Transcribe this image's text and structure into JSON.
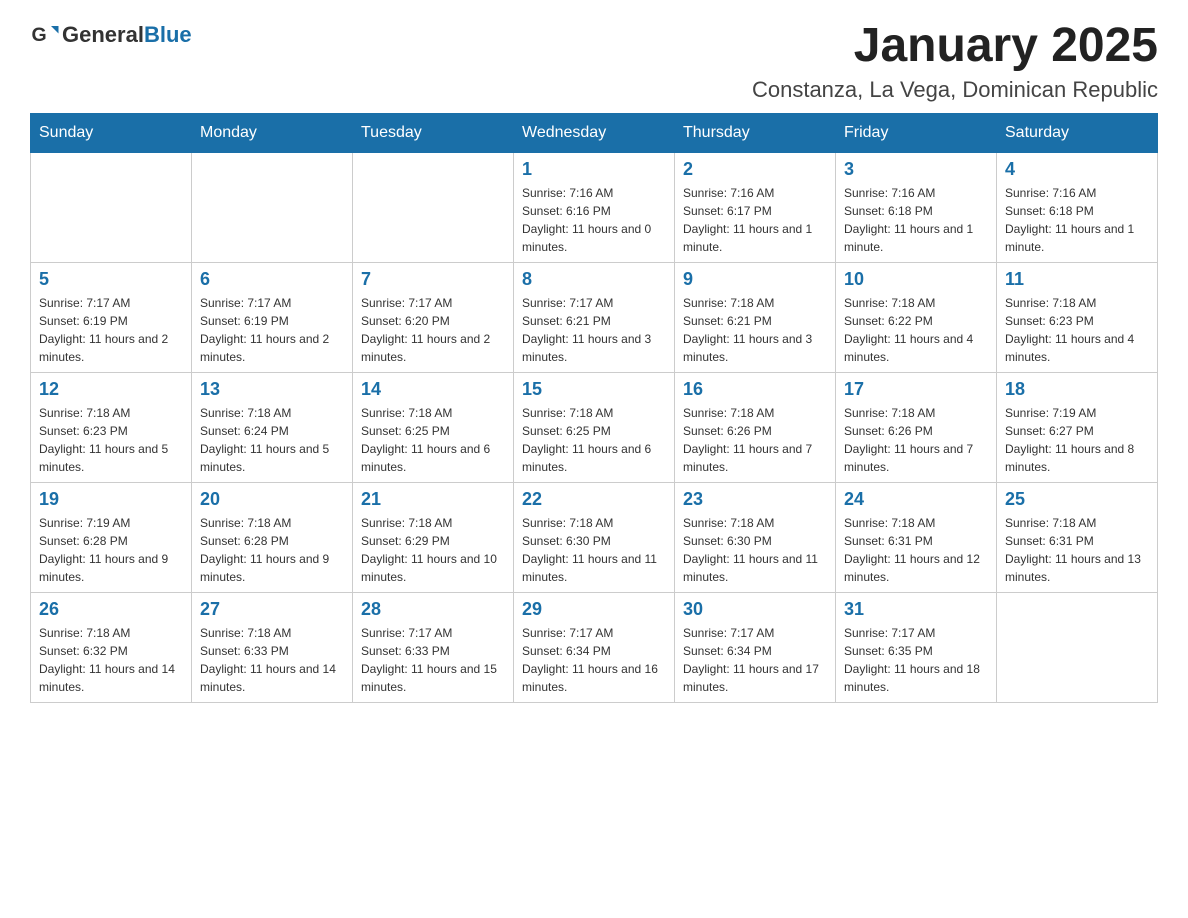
{
  "logo": {
    "general": "General",
    "blue": "Blue"
  },
  "header": {
    "month": "January 2025",
    "location": "Constanza, La Vega, Dominican Republic"
  },
  "weekdays": [
    "Sunday",
    "Monday",
    "Tuesday",
    "Wednesday",
    "Thursday",
    "Friday",
    "Saturday"
  ],
  "weeks": [
    [
      {
        "day": "",
        "info": ""
      },
      {
        "day": "",
        "info": ""
      },
      {
        "day": "",
        "info": ""
      },
      {
        "day": "1",
        "info": "Sunrise: 7:16 AM\nSunset: 6:16 PM\nDaylight: 11 hours and 0 minutes."
      },
      {
        "day": "2",
        "info": "Sunrise: 7:16 AM\nSunset: 6:17 PM\nDaylight: 11 hours and 1 minute."
      },
      {
        "day": "3",
        "info": "Sunrise: 7:16 AM\nSunset: 6:18 PM\nDaylight: 11 hours and 1 minute."
      },
      {
        "day": "4",
        "info": "Sunrise: 7:16 AM\nSunset: 6:18 PM\nDaylight: 11 hours and 1 minute."
      }
    ],
    [
      {
        "day": "5",
        "info": "Sunrise: 7:17 AM\nSunset: 6:19 PM\nDaylight: 11 hours and 2 minutes."
      },
      {
        "day": "6",
        "info": "Sunrise: 7:17 AM\nSunset: 6:19 PM\nDaylight: 11 hours and 2 minutes."
      },
      {
        "day": "7",
        "info": "Sunrise: 7:17 AM\nSunset: 6:20 PM\nDaylight: 11 hours and 2 minutes."
      },
      {
        "day": "8",
        "info": "Sunrise: 7:17 AM\nSunset: 6:21 PM\nDaylight: 11 hours and 3 minutes."
      },
      {
        "day": "9",
        "info": "Sunrise: 7:18 AM\nSunset: 6:21 PM\nDaylight: 11 hours and 3 minutes."
      },
      {
        "day": "10",
        "info": "Sunrise: 7:18 AM\nSunset: 6:22 PM\nDaylight: 11 hours and 4 minutes."
      },
      {
        "day": "11",
        "info": "Sunrise: 7:18 AM\nSunset: 6:23 PM\nDaylight: 11 hours and 4 minutes."
      }
    ],
    [
      {
        "day": "12",
        "info": "Sunrise: 7:18 AM\nSunset: 6:23 PM\nDaylight: 11 hours and 5 minutes."
      },
      {
        "day": "13",
        "info": "Sunrise: 7:18 AM\nSunset: 6:24 PM\nDaylight: 11 hours and 5 minutes."
      },
      {
        "day": "14",
        "info": "Sunrise: 7:18 AM\nSunset: 6:25 PM\nDaylight: 11 hours and 6 minutes."
      },
      {
        "day": "15",
        "info": "Sunrise: 7:18 AM\nSunset: 6:25 PM\nDaylight: 11 hours and 6 minutes."
      },
      {
        "day": "16",
        "info": "Sunrise: 7:18 AM\nSunset: 6:26 PM\nDaylight: 11 hours and 7 minutes."
      },
      {
        "day": "17",
        "info": "Sunrise: 7:18 AM\nSunset: 6:26 PM\nDaylight: 11 hours and 7 minutes."
      },
      {
        "day": "18",
        "info": "Sunrise: 7:19 AM\nSunset: 6:27 PM\nDaylight: 11 hours and 8 minutes."
      }
    ],
    [
      {
        "day": "19",
        "info": "Sunrise: 7:19 AM\nSunset: 6:28 PM\nDaylight: 11 hours and 9 minutes."
      },
      {
        "day": "20",
        "info": "Sunrise: 7:18 AM\nSunset: 6:28 PM\nDaylight: 11 hours and 9 minutes."
      },
      {
        "day": "21",
        "info": "Sunrise: 7:18 AM\nSunset: 6:29 PM\nDaylight: 11 hours and 10 minutes."
      },
      {
        "day": "22",
        "info": "Sunrise: 7:18 AM\nSunset: 6:30 PM\nDaylight: 11 hours and 11 minutes."
      },
      {
        "day": "23",
        "info": "Sunrise: 7:18 AM\nSunset: 6:30 PM\nDaylight: 11 hours and 11 minutes."
      },
      {
        "day": "24",
        "info": "Sunrise: 7:18 AM\nSunset: 6:31 PM\nDaylight: 11 hours and 12 minutes."
      },
      {
        "day": "25",
        "info": "Sunrise: 7:18 AM\nSunset: 6:31 PM\nDaylight: 11 hours and 13 minutes."
      }
    ],
    [
      {
        "day": "26",
        "info": "Sunrise: 7:18 AM\nSunset: 6:32 PM\nDaylight: 11 hours and 14 minutes."
      },
      {
        "day": "27",
        "info": "Sunrise: 7:18 AM\nSunset: 6:33 PM\nDaylight: 11 hours and 14 minutes."
      },
      {
        "day": "28",
        "info": "Sunrise: 7:17 AM\nSunset: 6:33 PM\nDaylight: 11 hours and 15 minutes."
      },
      {
        "day": "29",
        "info": "Sunrise: 7:17 AM\nSunset: 6:34 PM\nDaylight: 11 hours and 16 minutes."
      },
      {
        "day": "30",
        "info": "Sunrise: 7:17 AM\nSunset: 6:34 PM\nDaylight: 11 hours and 17 minutes."
      },
      {
        "day": "31",
        "info": "Sunrise: 7:17 AM\nSunset: 6:35 PM\nDaylight: 11 hours and 18 minutes."
      },
      {
        "day": "",
        "info": ""
      }
    ]
  ]
}
